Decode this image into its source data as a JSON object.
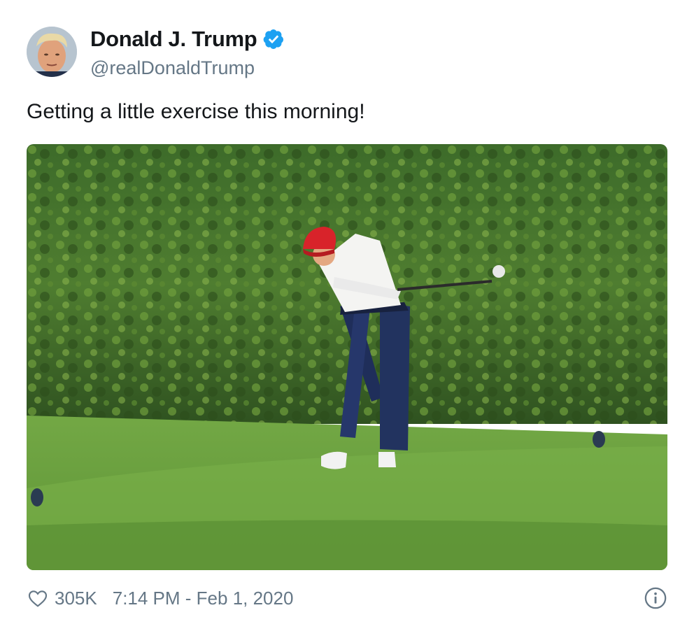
{
  "author": {
    "display_name": "Donald J. Trump",
    "handle": "@realDonaldTrump",
    "verified": true,
    "verified_color": "#1da1f2"
  },
  "tweet": {
    "text": "Getting a little exercise this morning!"
  },
  "footer": {
    "like_icon": "heart-outline-icon",
    "like_count": "305K",
    "timestamp": "7:14 PM - Feb 1, 2020",
    "info_icon": "info-circle-icon"
  },
  "colors": {
    "text_primary": "#14171a",
    "text_secondary": "#657786"
  }
}
